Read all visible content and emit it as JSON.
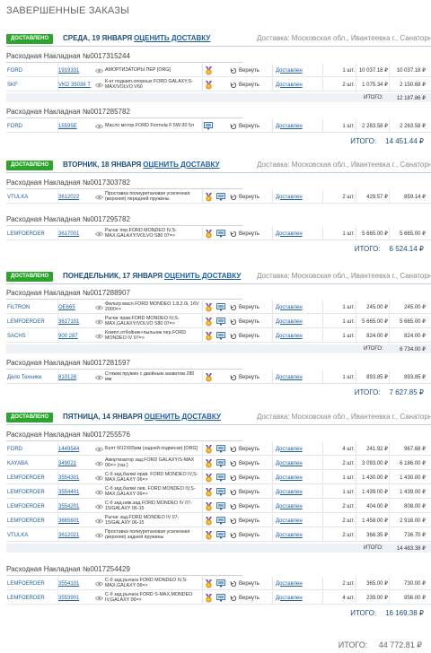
{
  "page_title": "ЗАВЕРШЕННЫЕ ЗАКАЗЫ",
  "badge": "ДОСТАВЛЕНО",
  "rate_label": "ОЦЕНИТЬ ДОСТАВКУ",
  "delivery_text": "Доставка:  Московская обл., Ивантеевка г., Санаторный",
  "invoice_prefix": "Расходная Накладная №",
  "return_label": "Вернуть",
  "status_label": "Доставлен",
  "subtotal_label": "ИТОГО:",
  "total_label": "ИТОГО:",
  "days": [
    {
      "title": "СРЕДА, 19 ЯНВАРЯ",
      "total": "14 451.44 ₽",
      "invoices": [
        {
          "number": "0017315244",
          "subtotal": "12 187.86 ₽",
          "rows": [
            {
              "brand": "FORD",
              "code": "1919331",
              "name": "АМОРТИЗАТОРЫ ПЕР [ORG]",
              "qty": "1 шт.",
              "price": "10 037.18 ₽",
              "sum": "10 037.18 ₽",
              "icons": [
                "medal"
              ]
            },
            {
              "brand": "SKF",
              "code": "VKD 35036 T",
              "name": "К-кт подшип.опорных FORD GALAXY,S-MAX/VOLVO V60",
              "qty": "2 шт.",
              "price": "1 075.34 ₽",
              "sum": "2 150.68 ₽",
              "icons": [
                "medal"
              ]
            }
          ]
        },
        {
          "number": "0017285782",
          "subtotal": "",
          "rows": [
            {
              "brand": "FORD",
              "code": "15595E",
              "name": "Масло мотор.FORD Formula F 5W-30 5л",
              "qty": "1 шт.",
              "price": "2 263.58 ₽",
              "sum": "2 263.58 ₽",
              "icons": [
                "monitor"
              ]
            }
          ]
        }
      ]
    },
    {
      "title": "ВТОРНИК, 18 ЯНВАРЯ",
      "total": "6 524.14 ₽",
      "invoices": [
        {
          "number": "0017303782",
          "subtotal": "",
          "rows": [
            {
              "brand": "VTULKA",
              "code": "3612022",
              "name": "Проставка полиуретановая усиленная (верхняя) передней пружины",
              "qty": "2 шт.",
              "price": "429.57 ₽",
              "sum": "859.14 ₽",
              "icons": [
                "medal",
                "monitor"
              ]
            }
          ]
        },
        {
          "number": "0017295782",
          "subtotal": "",
          "rows": [
            {
              "brand": "LEMFOERDER",
              "code": "3617001",
              "name": "Рычаг пер.FORD MONDEO IV,S-MAX,GALAXY/VOLVO S80 07=>",
              "qty": "1 шт.",
              "price": "5 665.00 ₽",
              "sum": "5 665.00 ₽",
              "icons": [
                "medal",
                "monitor"
              ]
            }
          ]
        }
      ]
    },
    {
      "title": "ПОНЕДЕЛЬНИК, 17 ЯНВАРЯ",
      "total": "7 627.85 ₽",
      "invoices": [
        {
          "number": "0017288907",
          "subtotal": "6 734.00 ₽",
          "rows": [
            {
              "brand": "FILTRON",
              "code": "OE665",
              "name": "Фильтр масл.FORD MONDEO 1.8,2.0i, 16V 2000=>",
              "qty": "1 шт.",
              "price": "245.00 ₽",
              "sum": "245.00 ₽",
              "icons": [
                "medal",
                "monitor"
              ]
            },
            {
              "brand": "LEMFOERDER",
              "code": "3617101",
              "name": "Рычаг прав.FORD MONDEO IV,S-MAX,GALAXY/VOLVO S80 07=>",
              "qty": "1 шт.",
              "price": "5 665.00 ₽",
              "sum": "5 665.00 ₽",
              "icons": [
                "medal",
                "monitor"
              ]
            },
            {
              "brand": "SACHS",
              "code": "900 287",
              "name": "Компл.отбойник+пыльник пер.FORD MONDEO IV 07=>",
              "qty": "1 шт.",
              "price": "824.00 ₽",
              "sum": "824.00 ₽",
              "icons": [
                "medal",
                "monitor"
              ]
            }
          ]
        },
        {
          "number": "0017281597",
          "subtotal": "",
          "rows": [
            {
              "brand": "Дело Техники",
              "code": "810128",
              "name": "Стяжки пружин с двойным захватом 280 мм",
              "qty": "1 шт.",
              "price": "893.85 ₽",
              "sum": "893.85 ₽",
              "icons": [
                "medal"
              ]
            }
          ]
        }
      ]
    },
    {
      "title": "ПЯТНИЦА, 14 ЯНВАРЯ",
      "total": "16 169.38 ₽",
      "invoices": [
        {
          "number": "0017255576",
          "subtotal": "14 483.38 ₽",
          "rows": [
            {
              "brand": "FORD",
              "code": "1449544",
              "name": "Болт М12Х65мм (задней подвески) [ORG]",
              "qty": "4 шт.",
              "price": "241.92 ₽",
              "sum": "967.68 ₽",
              "icons": [
                "medal",
                "monitor"
              ]
            },
            {
              "brand": "KAYABA",
              "code": "349021",
              "name": "Амортизатор зад.FORD GALAXY/S-MAX 06=> (газ.)",
              "qty": "2 шт.",
              "price": "3 093.00 ₽",
              "sum": "6 186.00 ₽",
              "icons": [
                "medal",
                "monitor"
              ]
            },
            {
              "brand": "LEMFOERDER",
              "code": "3554301",
              "name": "С-б зад.балки прав. FORD MONDEO IV,S-MAX,GALAXY 06=>",
              "qty": "1 шт.",
              "price": "1 430.00 ₽",
              "sum": "1 430.00 ₽",
              "icons": [
                "medal",
                "monitor"
              ]
            },
            {
              "brand": "LEMFOERDER",
              "code": "3554401",
              "name": "С-б зад.балки лев. FORD MONDEO IV,S-MAX,GALAXY 06=>",
              "qty": "1 шт.",
              "price": "1 439.00 ₽",
              "sum": "1 439.00 ₽",
              "icons": [
                "medal",
                "monitor"
              ]
            },
            {
              "brand": "LEMFOERDER",
              "code": "3554201",
              "name": "С-б зад.ниж.зад.FORD MONDEO IV 07-15/GALAXY 06-15",
              "qty": "2 шт.",
              "price": "404.00 ₽",
              "sum": "808.00 ₽",
              "icons": [
                "medal",
                "monitor"
              ]
            },
            {
              "brand": "LEMFOERDER",
              "code": "3665601",
              "name": "Рычаг зад.FORD MONDEO IV 07-15/GALAXY 06-15",
              "qty": "2 шт.",
              "price": "1 458.00 ₽",
              "sum": "2 916.00 ₽",
              "icons": [
                "medal",
                "monitor"
              ]
            },
            {
              "brand": "VTULKA",
              "code": "3612021",
              "name": "Проставка полиуретановая усиленная (верхняя) задней пружины",
              "qty": "2 шт.",
              "price": "368.35 ₽",
              "sum": "736.70 ₽",
              "icons": [
                "medal",
                "monitor"
              ]
            }
          ]
        },
        {
          "number": "0017254429",
          "subtotal": "",
          "rows": [
            {
              "brand": "LEMFOERDER",
              "code": "3554101",
              "name": "С-б зад.рычага FORD MONDEO IV,S-MAX,GALAXY 06=>",
              "qty": "2 шт.",
              "price": "365.00 ₽",
              "sum": "730.00 ₽",
              "icons": [
                "medal",
                "monitor"
              ]
            },
            {
              "brand": "LEMFOERDER",
              "code": "3553901",
              "name": "С-б зад.рычага FORD S-MAX,MONDEO IV,GALAXY 06=>",
              "qty": "4 шт.",
              "price": "239.00 ₽",
              "sum": "956.00 ₽",
              "icons": [
                "medal",
                "monitor"
              ]
            }
          ]
        }
      ]
    }
  ],
  "grand_total": "44 772.81 ₽",
  "colors": {
    "badge": "#2da42d",
    "link": "#1f5fa8",
    "title": "#1d4d7a",
    "medal": "#e89a1c"
  }
}
